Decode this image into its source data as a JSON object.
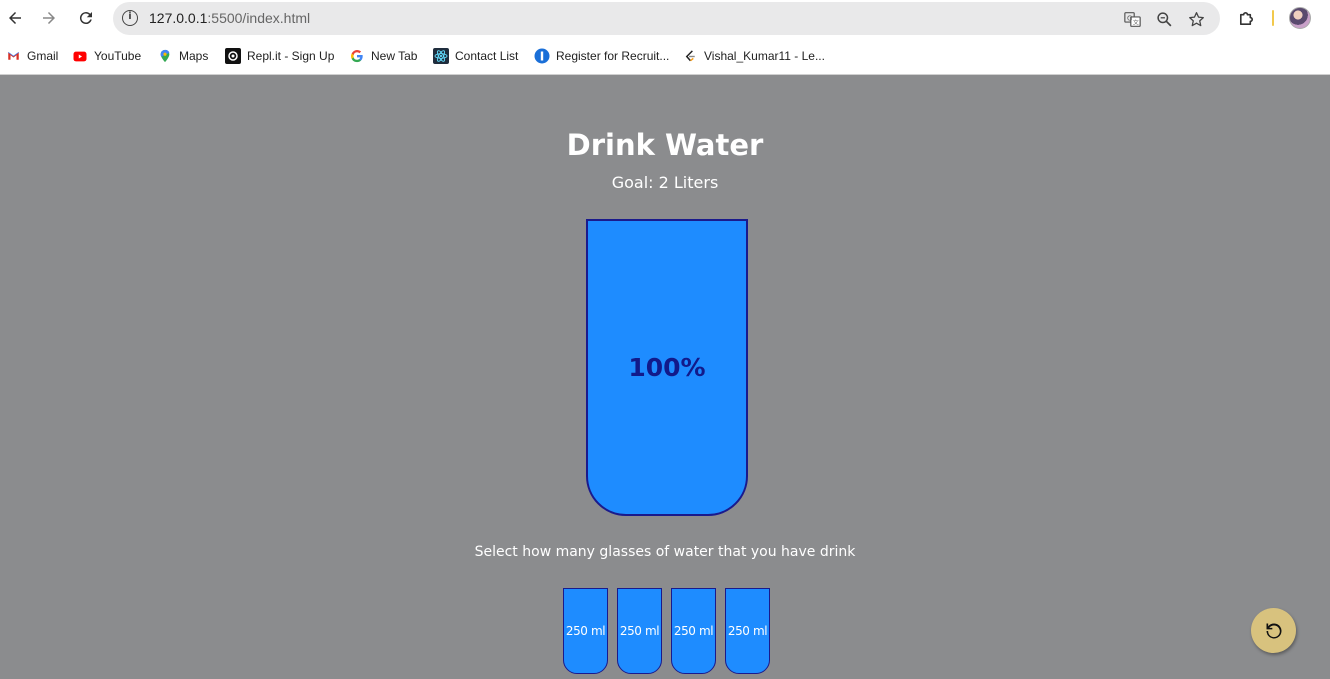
{
  "browser": {
    "url_host": "127.0.0.1",
    "url_rest": ":5500/index.html",
    "bookmarks": [
      {
        "label": "Gmail",
        "icon": "gmail-icon"
      },
      {
        "label": "YouTube",
        "icon": "youtube-icon"
      },
      {
        "label": "Maps",
        "icon": "maps-icon"
      },
      {
        "label": "Repl.it - Sign Up",
        "icon": "replit-icon"
      },
      {
        "label": "New Tab",
        "icon": "google-icon"
      },
      {
        "label": "Contact List",
        "icon": "react-icon"
      },
      {
        "label": "Register for Recruit...",
        "icon": "register-icon"
      },
      {
        "label": "Vishal_Kumar11 - Le...",
        "icon": "leetcode-icon"
      }
    ]
  },
  "app": {
    "title": "Drink Water",
    "goal": "Goal: 2 Liters",
    "percentage": "100%",
    "instruction": "Select how many glasses of water that you have drink",
    "cups": [
      "250 ml",
      "250 ml",
      "250 ml",
      "250 ml"
    ]
  },
  "colors": {
    "background": "#8b8c8e",
    "water": "#1e8cff",
    "cup_border": "#1a1a8c",
    "reset_button": "#d8c27e"
  }
}
